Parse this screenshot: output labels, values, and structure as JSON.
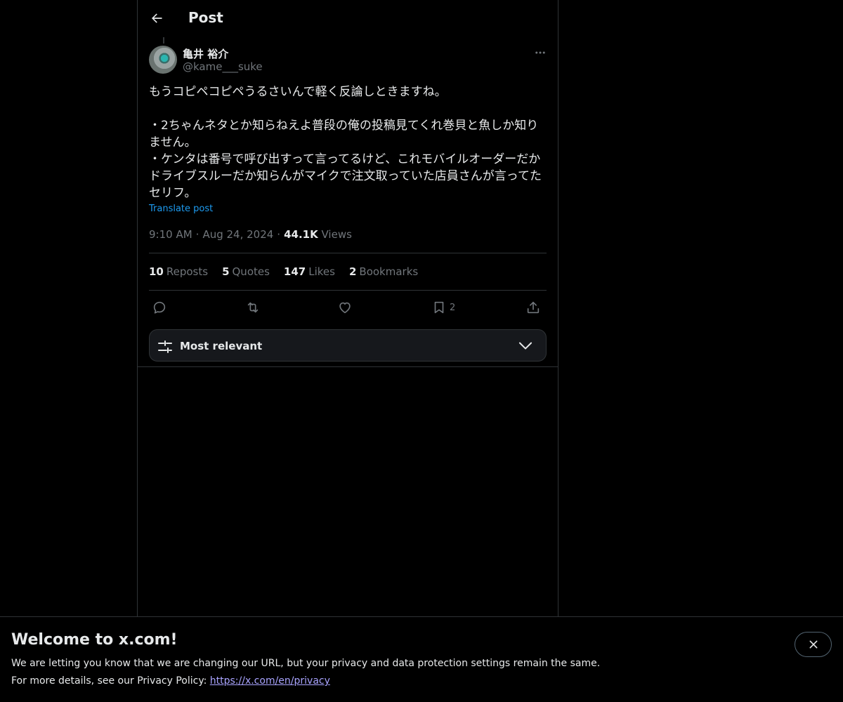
{
  "header": {
    "title": "Post"
  },
  "author": {
    "name": "亀井 裕介",
    "handle": "@kame___suke"
  },
  "tweet": {
    "text": "もうコピペコピペうるさいんで軽く反論しときますね。\n\n・2ちゃんネタとか知らねえよ普段の俺の投稿見てくれ巻貝と魚しか知りません。\n・ケンタは番号で呼び出すって言ってるけど、これモバイルオーダーだかドライブスルーだか知らんがマイクで注文取っていた店員さんが言ってたセリフ。",
    "translate_label": "Translate post",
    "time": "9:10 AM",
    "date": "Aug 24, 2024",
    "sep": "·",
    "views_count": "44.1K",
    "views_label": "Views"
  },
  "stats": [
    {
      "count": "10",
      "label": "Reposts"
    },
    {
      "count": "5",
      "label": "Quotes"
    },
    {
      "count": "147",
      "label": "Likes"
    },
    {
      "count": "2",
      "label": "Bookmarks"
    }
  ],
  "actions": {
    "reply_icon": "reply-icon",
    "repost_icon": "repost-icon",
    "like_icon": "heart-icon",
    "bookmark_icon": "bookmark-icon",
    "bookmark_count": "2",
    "share_icon": "share-icon"
  },
  "sort": {
    "label": "Most relevant"
  },
  "banner": {
    "title": "Welcome to x.com!",
    "line1": "We are letting you know that we are changing our URL, but your privacy and data protection settings remain the same.",
    "line2_prefix": "For more details, see our Privacy Policy: ",
    "link": "https://x.com/en/privacy"
  },
  "colors": {
    "background": "#000000",
    "text": "#e7e9ea",
    "muted": "#71767b",
    "accent": "#1d9bf0",
    "border": "#2f3336"
  }
}
